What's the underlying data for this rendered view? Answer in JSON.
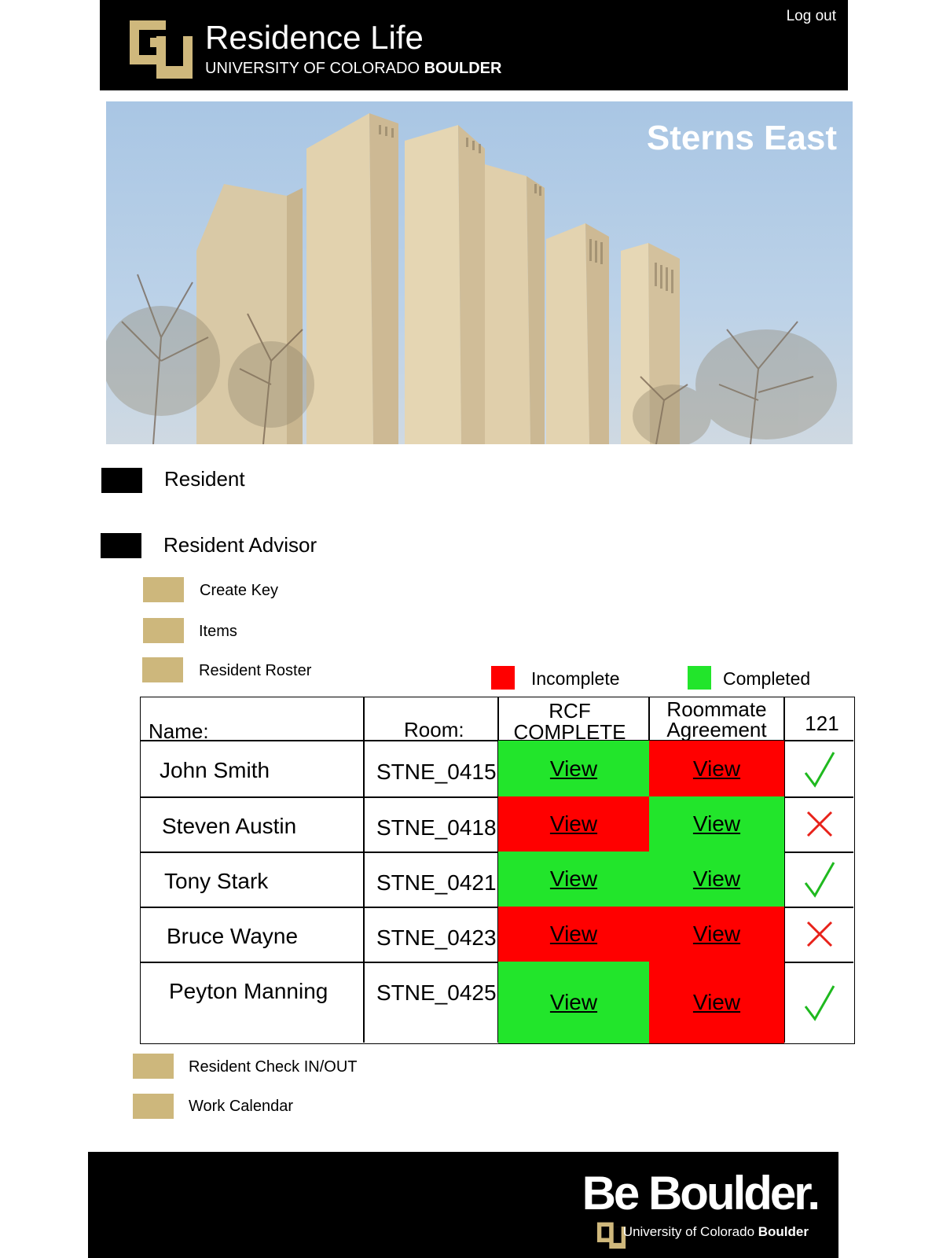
{
  "header": {
    "title": "Residence Life",
    "subtitle_prefix": "UNIVERSITY OF COLORADO ",
    "subtitle_bold": "BOULDER",
    "logout_label": "Log out"
  },
  "hero": {
    "hall_name": "Sterns East"
  },
  "nav": {
    "resident_label": "Resident",
    "advisor_label": "Resident Advisor",
    "advisor_items": [
      "Create Key",
      "Items",
      "Resident Roster"
    ],
    "bottom_items": [
      "Resident Check IN/OUT",
      "Work Calendar"
    ]
  },
  "legend": {
    "incomplete_label": "Incomplete",
    "completed_label": "Completed",
    "incomplete_color": "#ff0000",
    "completed_color": "#22e52b"
  },
  "roster": {
    "headers": {
      "name": "Name:",
      "room": "Room:",
      "rcf_line1": "RCF",
      "rcf_line2": "COMPLETE",
      "agreement_line1": "Roommate",
      "agreement_line2": "Agreement",
      "count": "121"
    },
    "view_label": "View",
    "rows": [
      {
        "name": "John Smith",
        "room": "STNE_0415",
        "rcf": "complete",
        "agreement": "incomplete",
        "ok": true
      },
      {
        "name": "Steven Austin",
        "room": "STNE_0418",
        "rcf": "incomplete",
        "agreement": "complete",
        "ok": false
      },
      {
        "name": "Tony Stark",
        "room": "STNE_0421",
        "rcf": "complete",
        "agreement": "complete",
        "ok": true
      },
      {
        "name": "Bruce Wayne",
        "room": "STNE_0423",
        "rcf": "incomplete",
        "agreement": "incomplete",
        "ok": false
      },
      {
        "name": "Peyton Manning",
        "room": "STNE_0425",
        "rcf": "complete",
        "agreement": "incomplete",
        "ok": true
      }
    ]
  },
  "footer": {
    "tagline": "Be Boulder.",
    "univ_prefix": "University of Colorado ",
    "univ_bold": "Boulder"
  },
  "icons": {
    "check": "check-icon",
    "cross": "cross-icon",
    "logo": "cu-logo-icon"
  }
}
